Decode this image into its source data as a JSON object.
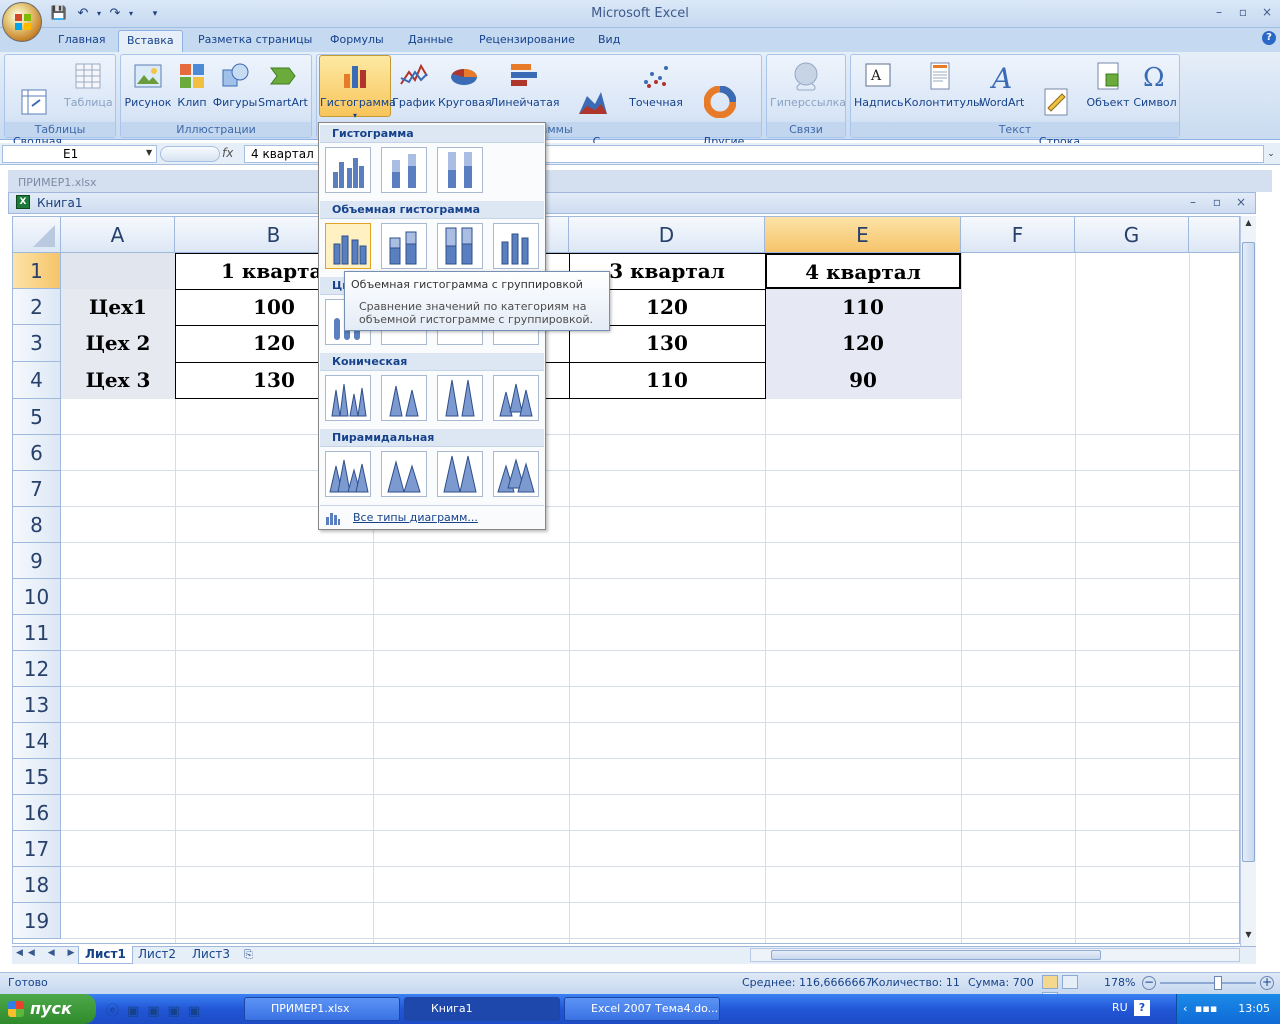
{
  "app": {
    "title": "Microsoft Excel",
    "window_controls": [
      "–",
      "▫",
      "×"
    ]
  },
  "ribbon_tabs": [
    "Главная",
    "Вставка",
    "Разметка страницы",
    "Формулы",
    "Данные",
    "Рецензирование",
    "Вид"
  ],
  "ribbon": {
    "groups": [
      {
        "label": "Таблицы"
      },
      {
        "label": "Иллюстрации"
      },
      {
        "label": "Диаграммы"
      },
      {
        "label": "Связи"
      },
      {
        "label": "Текст"
      }
    ],
    "buttons": {
      "pivot": "Сводная\nтаблица ▾",
      "table": "Таблица",
      "picture": "Рисунок",
      "clip": "Клип",
      "shapes": "Фигуры",
      "smartart": "SmartArt",
      "histogram": "Гистограмма",
      "graph": "График",
      "pie": "Круговая",
      "bar": "Линейчатая",
      "area": "С\nобластями ▾",
      "scatter": "Точечная",
      "other": "Другие\nдиаграммы ▾",
      "hyperlink": "Гиперссылка",
      "textbox": "Надпись",
      "header": "Колонтитулы",
      "wordart": "WordArt",
      "signature": "Строка\nподписи ▾",
      "object": "Объект",
      "symbol": "Символ"
    }
  },
  "formula_bar": {
    "name_box": "E1",
    "fx": "fx",
    "value": "4 квартал"
  },
  "background_doc": "ПРИМЕР1.xlsx",
  "workbook": {
    "title": "Книга1",
    "columns": [
      "A",
      "B",
      "C",
      "D",
      "E",
      "F",
      "G"
    ],
    "rows": [
      "1",
      "2",
      "3",
      "4",
      "5",
      "6",
      "7",
      "8",
      "9",
      "10",
      "11",
      "12",
      "13",
      "14",
      "15",
      "16",
      "17",
      "18",
      "19"
    ],
    "cells": {
      "B1": "1 квартал",
      "D1": "3 квартал",
      "E1": "4 квартал",
      "A2": "Цех1",
      "B2": "100",
      "D2": "120",
      "E2": "110",
      "A3": "Цех 2",
      "B3": "120",
      "D3": "130",
      "E3": "120",
      "A4": "Цех 3",
      "B4": "130",
      "D4": "110",
      "E4": "90"
    },
    "sheets": [
      "Лист1",
      "Лист2",
      "Лист3"
    ]
  },
  "chart_menu": {
    "sections": [
      "Гистограмма",
      "Объемная гистограмма",
      "Ци",
      "Коническая",
      "Пирамидальная"
    ],
    "all_types": "Все типы диаграмм..."
  },
  "tooltip": {
    "title": "Объемная гистограмма с группировкой",
    "body": "Сравнение значений по категориям на объемной гистограмме с группировкой."
  },
  "status": {
    "ready": "Готово",
    "average": "Среднее: 116,6666667",
    "count": "Количество: 11",
    "sum": "Сумма: 700",
    "zoom": "178%"
  },
  "taskbar": {
    "start": "пуск",
    "tasks": [
      "ПРИМЕР1.xlsx",
      "Книга1",
      "Excel 2007 Тема4.do..."
    ],
    "lang": "RU",
    "clock": "13:05"
  }
}
